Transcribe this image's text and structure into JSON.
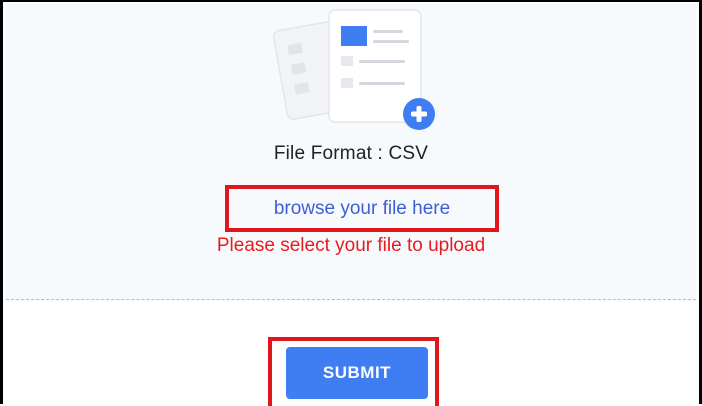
{
  "upload": {
    "format_label": "File Format : CSV",
    "browse_text": "browse your file here",
    "error_text": "Please select your file to upload"
  },
  "actions": {
    "submit_label": "SUBMIT"
  },
  "icons": {
    "illustration": "document-add-icon",
    "plus": "plus-circle-icon"
  },
  "colors": {
    "accent_blue": "#3f7df2",
    "link_blue": "#3d5ed6",
    "error_red": "#e81b1f",
    "highlight_red": "#e0161c"
  }
}
